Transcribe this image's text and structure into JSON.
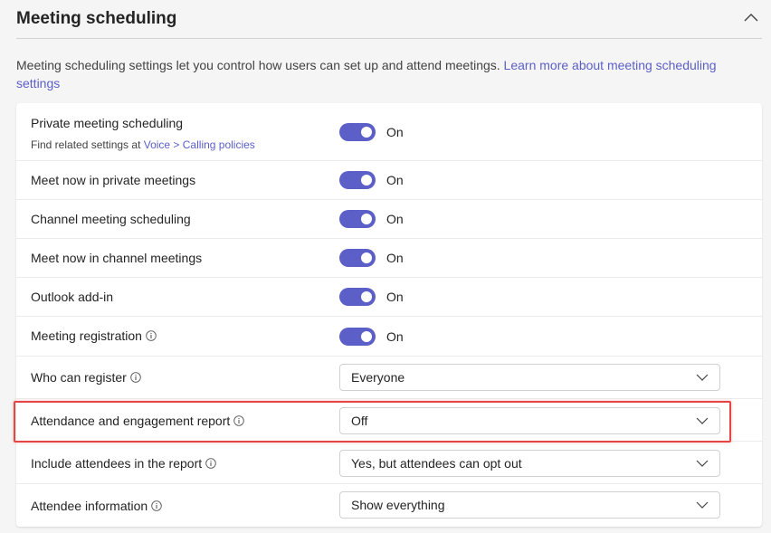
{
  "section": {
    "title": "Meeting scheduling",
    "description": "Meeting scheduling settings let you control how users can set up and attend meetings.",
    "learn_more_link": "Learn more about meeting scheduling settings"
  },
  "settings": [
    {
      "label": "Private meeting scheduling",
      "sub_prefix": "Find related settings at ",
      "sub_link": "Voice > Calling policies",
      "type": "toggle",
      "value": "On",
      "enabled": true
    },
    {
      "label": "Meet now in private meetings",
      "type": "toggle",
      "value": "On",
      "enabled": true
    },
    {
      "label": "Channel meeting scheduling",
      "type": "toggle",
      "value": "On",
      "enabled": true
    },
    {
      "label": "Meet now in channel meetings",
      "type": "toggle",
      "value": "On",
      "enabled": true
    },
    {
      "label": "Outlook add-in",
      "type": "toggle",
      "value": "On",
      "enabled": true
    },
    {
      "label": "Meeting registration",
      "info": true,
      "type": "toggle",
      "value": "On",
      "enabled": true
    },
    {
      "label": "Who can register",
      "info": true,
      "type": "select",
      "value": "Everyone"
    },
    {
      "label": "Attendance and engagement report",
      "info": true,
      "type": "select",
      "value": "Off",
      "highlighted": true
    },
    {
      "label": "Include attendees in the report",
      "info": true,
      "type": "select",
      "value": "Yes, but attendees can opt out"
    },
    {
      "label": "Attendee information",
      "info": true,
      "type": "select",
      "value": "Show everything"
    }
  ],
  "icons": {
    "collapse": "chevron-up-icon",
    "info": "info-icon",
    "dropdown": "chevron-down-icon"
  },
  "colors": {
    "accent": "#5b5fc7",
    "highlight": "#e64545"
  }
}
